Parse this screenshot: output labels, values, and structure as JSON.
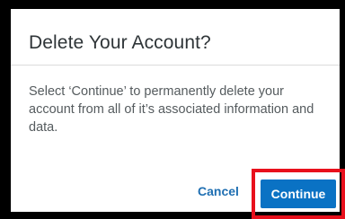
{
  "dialog": {
    "title": "Delete Your Account?",
    "message": "Select ‘Continue’ to permanently delete your account from all of it’s associated information and data.",
    "cancel_label": "Cancel",
    "continue_label": "Continue"
  },
  "colors": {
    "primary": "#0a72c4",
    "link": "#1f6fb2",
    "highlight": "#e8101c",
    "background": "#000000"
  }
}
